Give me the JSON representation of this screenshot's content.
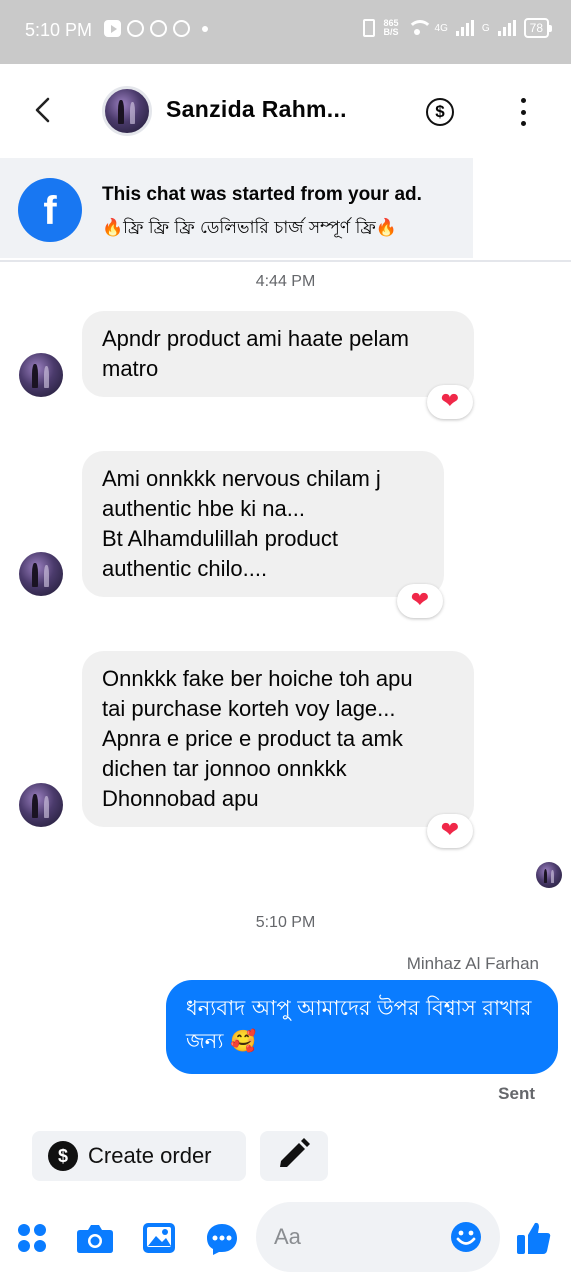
{
  "status_bar": {
    "time": "5:10 PM",
    "net_speed_value": "865",
    "net_speed_unit": "B/S",
    "net_4g": "4G",
    "net_g": "G",
    "battery": "78"
  },
  "header": {
    "contact_name": "Sanzida Rahm...",
    "back_icon": "back-arrow-icon",
    "dollar_symbol": "$"
  },
  "ad_banner": {
    "title": "This chat was started from your ad.",
    "subtitle": "🔥ফ্রি ফ্রি ফ্রি  ডেলিভারি চার্জ সম্পূর্ণ ফ্রি🔥",
    "logo_letter": "f"
  },
  "messages": {
    "timestamp_1": "4:44 PM",
    "incoming": [
      {
        "text": "Apndr product ami haate pelam\nmatro",
        "reaction": "❤"
      },
      {
        "text": "Ami onnkkk nervous chilam j\nauthentic hbe ki na...\nBt Alhamdulillah product\nauthentic chilo....",
        "reaction": "❤"
      },
      {
        "text": "Onnkkk fake ber hoiche toh apu\ntai purchase korteh voy lage...\nApnra e price e product ta amk\ndichen tar jonnoo onnkkk\nDhonnobad apu",
        "reaction": "❤"
      }
    ],
    "timestamp_2": "5:10 PM",
    "sender_name": "Minhaz Al Farhan",
    "outgoing_text": "ধন্যবাদ আপু আমাদের উপর বিশ্বাস রাখার জন্য 🥰",
    "status": "Sent"
  },
  "quick_actions": {
    "create_order_label": "Create order",
    "create_order_symbol": "$"
  },
  "composer": {
    "placeholder": "Aa"
  },
  "colors": {
    "messenger_blue": "#0a7cff",
    "facebook_blue": "#1877f2",
    "heart_red": "#f02849"
  }
}
